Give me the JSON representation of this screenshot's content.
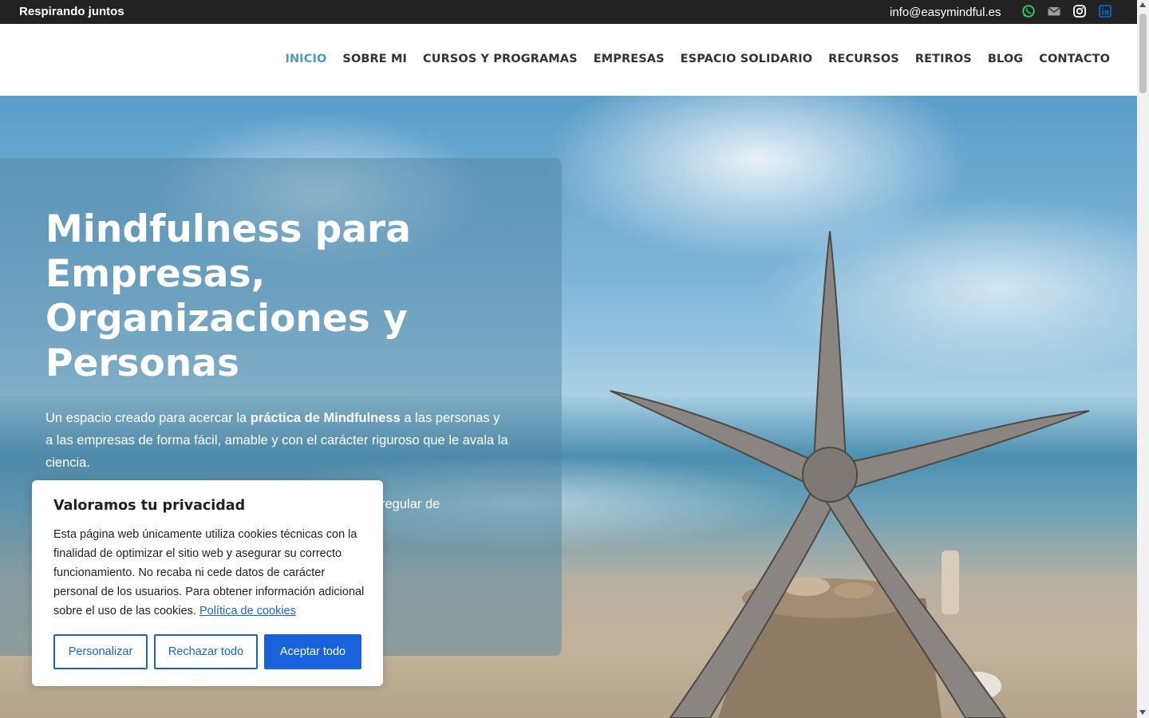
{
  "topbar": {
    "tagline": "Respirando juntos",
    "email": "info@easymindful.es",
    "social": [
      {
        "name": "whatsapp-icon",
        "color": "#25d366"
      },
      {
        "name": "mail-icon",
        "color": "#9e9e9e"
      },
      {
        "name": "instagram-icon",
        "color": "#ffffff"
      },
      {
        "name": "linkedin-icon",
        "color": "#0a66c2"
      }
    ]
  },
  "nav": {
    "items": [
      {
        "label": "INICIO",
        "active": true
      },
      {
        "label": "SOBRE MI"
      },
      {
        "label": "CURSOS Y PROGRAMAS"
      },
      {
        "label": "EMPRESAS"
      },
      {
        "label": "ESPACIO SOLIDARIO"
      },
      {
        "label": "RECURSOS"
      },
      {
        "label": "RETIROS"
      },
      {
        "label": "BLOG"
      },
      {
        "label": "CONTACTO"
      }
    ]
  },
  "hero": {
    "title": "Mindfulness para Empresas, Organizaciones y Personas",
    "text_before": "Un espacio creado para acercar la ",
    "text_bold": "práctica de Mindfulness",
    "text_after": " a las personas y a las empresas de forma fácil, amable y con el carácter riguroso que le avala la ciencia.",
    "text2_visible": "regular de"
  },
  "cookie": {
    "title": "Valoramos tu privacidad",
    "body": "Esta página web únicamente utiliza cookies técnicas con la finalidad de optimizar el sitio web y asegurar su correcto funcionamiento. No recaba ni cede datos de carácter personal de los usuarios. Para obtener información adicional sobre el uso de las cookies. ",
    "link": "Política de cookies",
    "buttons": {
      "customize": "Personalizar",
      "reject": "Rechazar todo",
      "accept": "Aceptar todo"
    },
    "accent": "#1863dc"
  }
}
